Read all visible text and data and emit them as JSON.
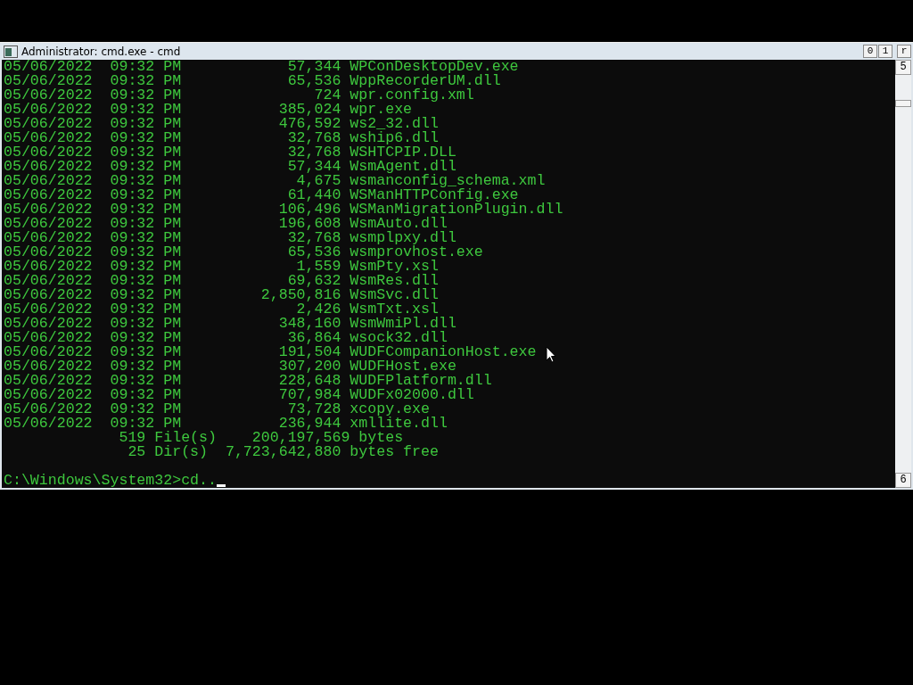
{
  "window": {
    "title": "Administrator: cmd.exe - cmd",
    "controls": [
      "0",
      "1",
      "r"
    ]
  },
  "console": {
    "lines": [
      "05/06/2022  09:32 PM            57,344 WPConDesktopDev.exe",
      "05/06/2022  09:32 PM            65,536 WppRecorderUM.dll",
      "05/06/2022  09:32 PM               724 wpr.config.xml",
      "05/06/2022  09:32 PM           385,024 wpr.exe",
      "05/06/2022  09:32 PM           476,592 ws2_32.dll",
      "05/06/2022  09:32 PM            32,768 wship6.dll",
      "05/06/2022  09:32 PM            32,768 WSHTCPIP.DLL",
      "05/06/2022  09:32 PM            57,344 WsmAgent.dll",
      "05/06/2022  09:32 PM             4,675 wsmanconfig_schema.xml",
      "05/06/2022  09:32 PM            61,440 WSManHTTPConfig.exe",
      "05/06/2022  09:32 PM           106,496 WSManMigrationPlugin.dll",
      "05/06/2022  09:32 PM           196,608 WsmAuto.dll",
      "05/06/2022  09:32 PM            32,768 wsmplpxy.dll",
      "05/06/2022  09:32 PM            65,536 wsmprovhost.exe",
      "05/06/2022  09:32 PM             1,559 WsmPty.xsl",
      "05/06/2022  09:32 PM            69,632 WsmRes.dll",
      "05/06/2022  09:32 PM         2,850,816 WsmSvc.dll",
      "05/06/2022  09:32 PM             2,426 WsmTxt.xsl",
      "05/06/2022  09:32 PM           348,160 WsmWmiPl.dll",
      "05/06/2022  09:32 PM            36,864 wsock32.dll",
      "05/06/2022  09:32 PM           191,504 WUDFCompanionHost.exe",
      "05/06/2022  09:32 PM           307,200 WUDFHost.exe",
      "05/06/2022  09:32 PM           228,648 WUDFPlatform.dll",
      "05/06/2022  09:32 PM           707,984 WUDFx02000.dll",
      "05/06/2022  09:32 PM            73,728 xcopy.exe",
      "05/06/2022  09:32 PM           236,944 xmllite.dll",
      "             519 File(s)    200,197,569 bytes",
      "              25 Dir(s)  7,723,642,880 bytes free"
    ],
    "prompt": "C:\\Windows\\System32>cd.."
  },
  "scrollbar": {
    "up": "5",
    "down": "6"
  }
}
